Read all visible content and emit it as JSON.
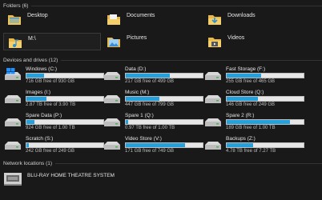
{
  "groups": {
    "folders": "Folders (6)",
    "devices": "Devices and drives (12)",
    "network": "Network locations (1)"
  },
  "folders": [
    {
      "label": "Desktop",
      "icon": "desktop-folder-icon"
    },
    {
      "label": "Documents",
      "icon": "documents-folder-icon"
    },
    {
      "label": "Downloads",
      "icon": "downloads-folder-icon"
    },
    {
      "label": "M:\\",
      "icon": "music-folder-icon"
    },
    {
      "label": "Pictures",
      "icon": "pictures-folder-icon"
    },
    {
      "label": "Videos",
      "icon": "videos-folder-icon"
    }
  ],
  "drives": [
    {
      "label": "Windows (C:)",
      "free": "716 GB free of 930 GB",
      "used_fraction": 0.23,
      "icon": "windows-drive-icon"
    },
    {
      "label": "Data (D:)",
      "free": "217 GB free of 499 GB",
      "used_fraction": 0.57,
      "icon": "hard-drive-icon"
    },
    {
      "label": "Fast Storage (F:)",
      "free": "255 GB free of 465 GB",
      "used_fraction": 0.45,
      "icon": "hard-drive-icon"
    },
    {
      "label": "Images (I:)",
      "free": "2.87 TB free of 3.90 TB",
      "used_fraction": 0.26,
      "icon": "hard-drive-icon"
    },
    {
      "label": "Music (M:)",
      "free": "447 GB free of 799 GB",
      "used_fraction": 0.44,
      "icon": "hard-drive-icon"
    },
    {
      "label": "Cloud Store (Q:)",
      "free": "146 GB free of 249 GB",
      "used_fraction": 0.41,
      "icon": "hard-drive-icon"
    },
    {
      "label": "Spare Data (P:)",
      "free": "924 GB free of 1.00 TB",
      "used_fraction": 0.1,
      "icon": "hard-drive-icon"
    },
    {
      "label": "Spare 1 (Q:)",
      "free": "0.97 TB free of 1.00 TB",
      "used_fraction": 0.03,
      "icon": "hard-drive-icon"
    },
    {
      "label": "Spare 2 (R:)",
      "free": "189 GB free of 1.00 TB",
      "used_fraction": 0.82,
      "icon": "hard-drive-icon"
    },
    {
      "label": "Scratch (S:)",
      "free": "242 GB free of 249 GB",
      "used_fraction": 0.03,
      "icon": "hard-drive-icon"
    },
    {
      "label": "Video Store (V:)",
      "free": "171 GB free of 749 GB",
      "used_fraction": 0.77,
      "icon": "hard-drive-icon"
    },
    {
      "label": "Backups (Z:)",
      "free": "4.78 TB free of 7.27 TB",
      "used_fraction": 0.34,
      "icon": "hard-drive-icon"
    }
  ],
  "network": [
    {
      "label": "BLU-RAY HOME THEATRE SYSTEM",
      "icon": "media-device-icon"
    }
  ],
  "colors": {
    "accent": "#26a0da",
    "background": "#191919"
  }
}
